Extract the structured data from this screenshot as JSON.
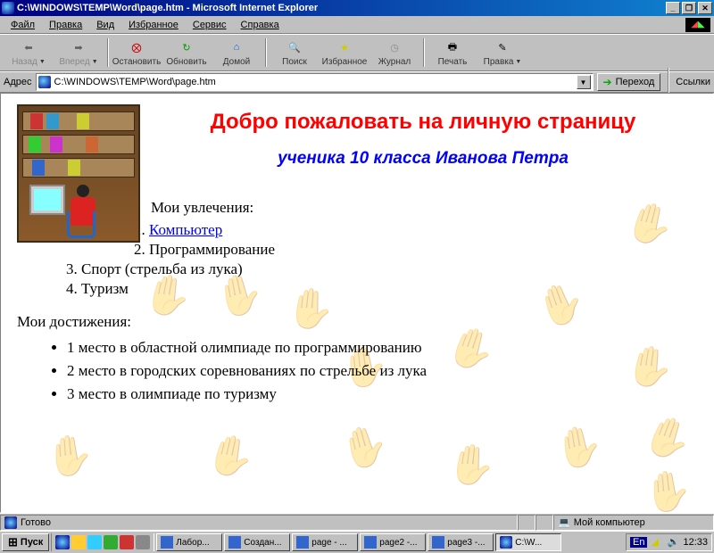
{
  "titlebar": {
    "title": "C:\\WINDOWS\\TEMP\\Word\\page.htm - Microsoft Internet Explorer"
  },
  "menu": {
    "items": [
      "Файл",
      "Правка",
      "Вид",
      "Избранное",
      "Сервис",
      "Справка"
    ]
  },
  "toolbar": {
    "back": "Назад",
    "forward": "Вперед",
    "stop": "Остановить",
    "refresh": "Обновить",
    "home": "Домой",
    "search": "Поиск",
    "favorites": "Избранное",
    "history": "Журнал",
    "print": "Печать",
    "edit": "Правка"
  },
  "addressbar": {
    "label": "Адрес",
    "url": "C:\\WINDOWS\\TEMP\\Word\\page.htm",
    "go": "Переход",
    "links": "Ссылки"
  },
  "page": {
    "h1": "Добро пожаловать на личную страницу",
    "h2": "ученика 10 класса Иванова Петра",
    "hobbies_title": "Мои увлечения:",
    "hobbies": [
      "Компьютер",
      "Программирование",
      "Спорт (стрельба из лука)",
      "Туризм"
    ],
    "achievements_title": "Мои достижения:",
    "achievements": [
      "1 место в областной олимпиаде по программированию",
      "2 место в городских соревнованиях по стрельбе из лука",
      "3 место в олимпиаде по туризму"
    ]
  },
  "statusbar": {
    "status": "Готово",
    "zone": "Мой компьютер"
  },
  "taskbar": {
    "start": "Пуск",
    "tasks": [
      "Лабор...",
      "Создан...",
      "page - ...",
      "page2 -...",
      "page3 -...",
      "C:\\W..."
    ],
    "lang": "En",
    "clock": "12:33"
  }
}
